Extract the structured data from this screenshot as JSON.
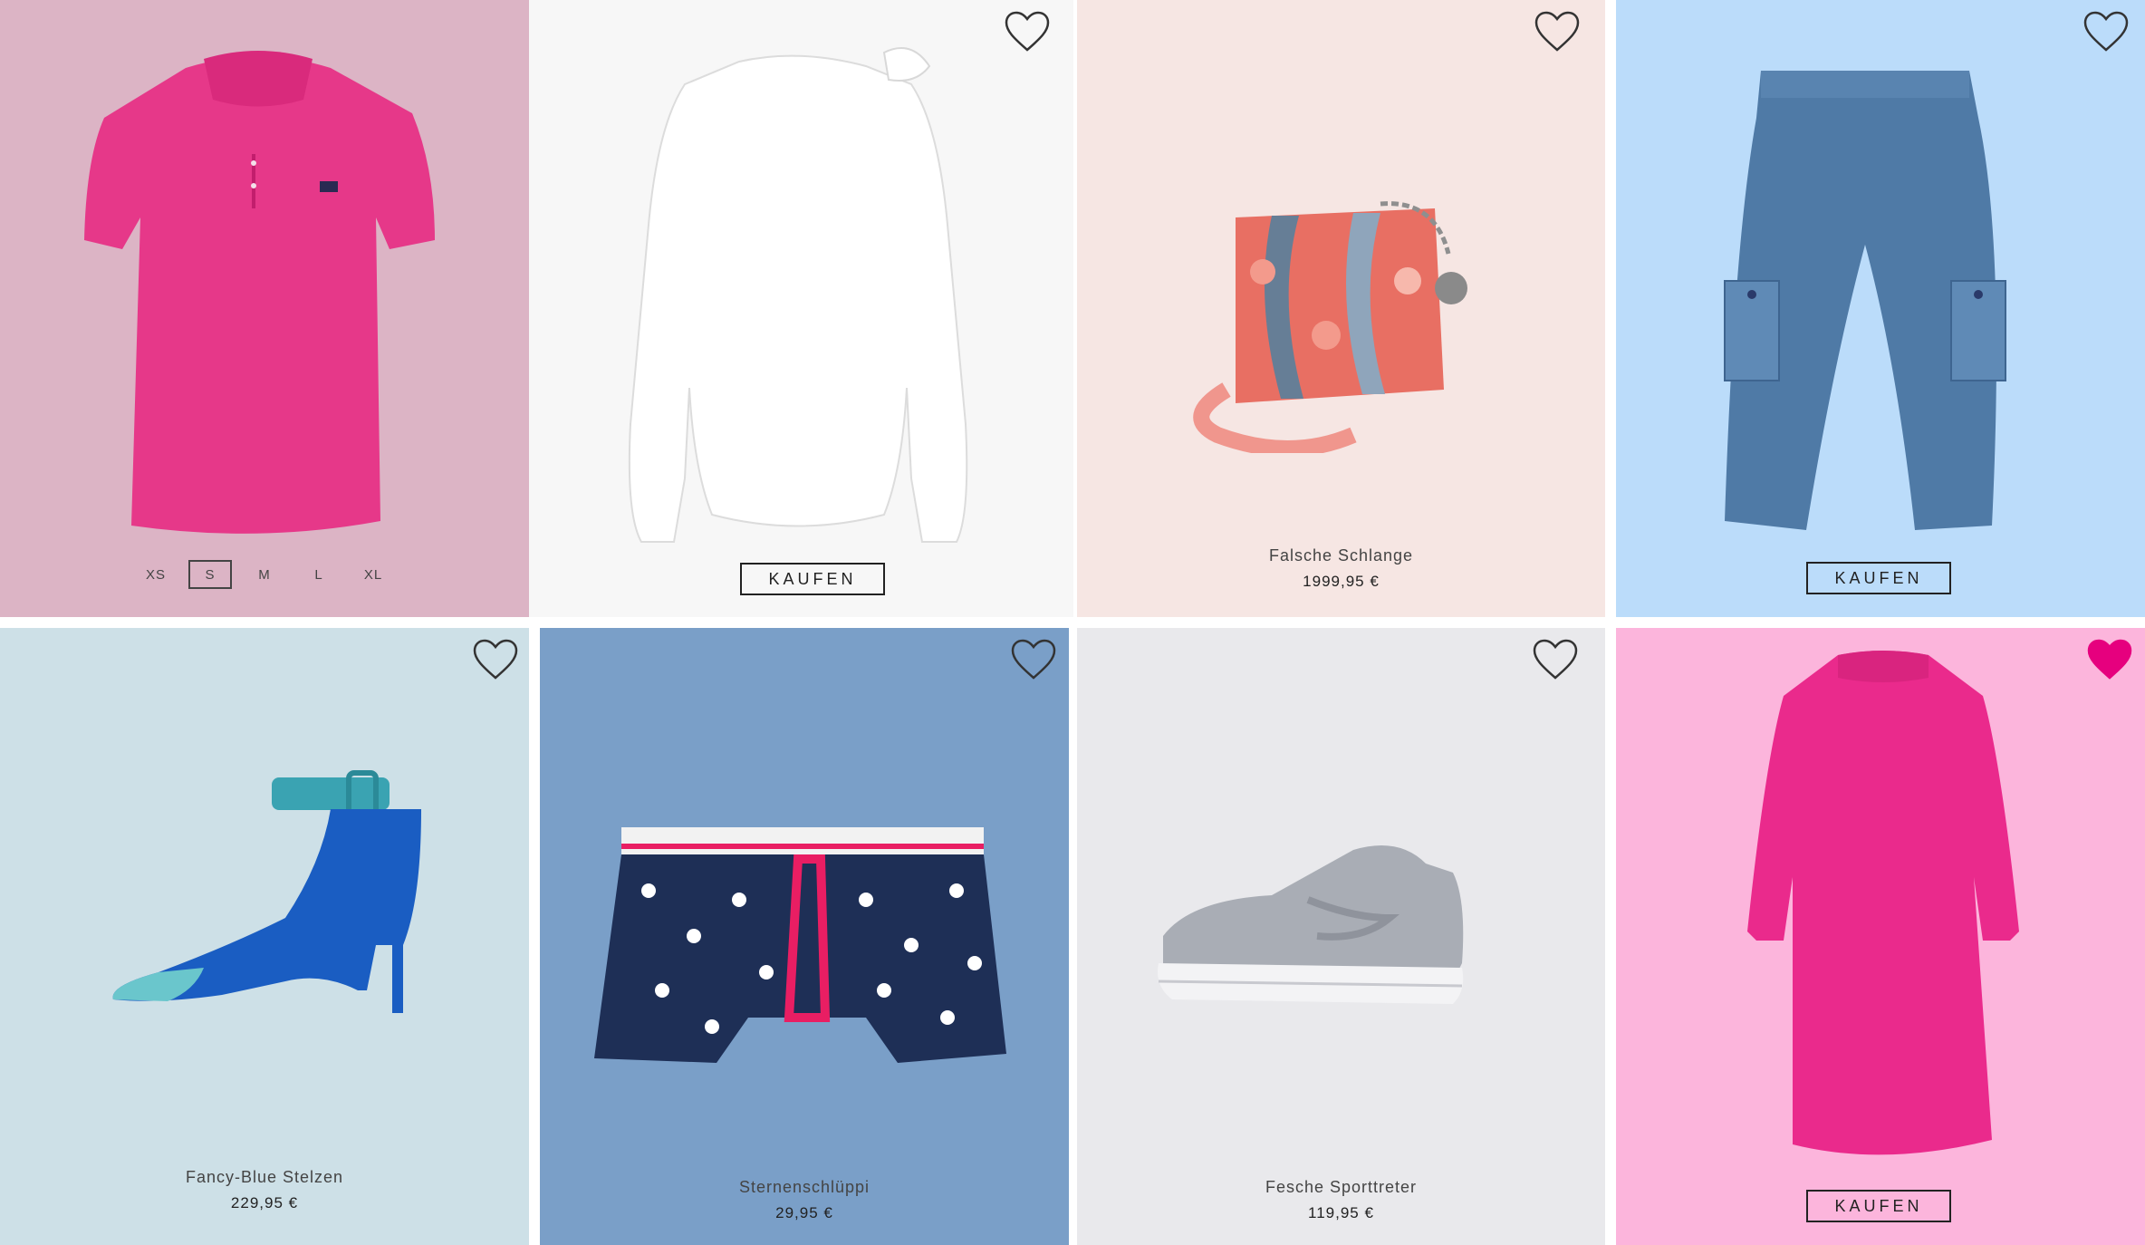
{
  "tiles": [
    {
      "name": "Polo Shirt",
      "bg": "#dcb4c5",
      "sizes": [
        "XS",
        "S",
        "M",
        "L",
        "XL"
      ],
      "selected_size": "S"
    },
    {
      "name": "Bluse",
      "bg": "#f7f7f7",
      "button": "KAUFEN",
      "favorite": false
    },
    {
      "name": "Falsche Schlange",
      "price": "1999,95 €",
      "bg": "#f6e6e3",
      "favorite": false
    },
    {
      "name": "Cargo Jeans",
      "bg": "#bbdcfa",
      "button": "KAUFEN",
      "favorite": false
    },
    {
      "name": "Fancy-Blue Stelzen",
      "price": "229,95 €",
      "bg": "#cde0e7",
      "favorite": false
    },
    {
      "name": "Sternenschlüppi",
      "price": "29,95 €",
      "bg": "#7a9fc8",
      "favorite": false
    },
    {
      "name": "Fesche Sporttreter",
      "price": "119,95 €",
      "bg": "#e9e9ec",
      "favorite": false
    },
    {
      "name": "Kleid",
      "bg": "#fcb5dc",
      "button": "KAUFEN",
      "favorite": true
    }
  ],
  "colors": {
    "favorite_active": "#e6007e",
    "outline": "#333333"
  },
  "icons": {
    "favorite": "heart-icon"
  }
}
